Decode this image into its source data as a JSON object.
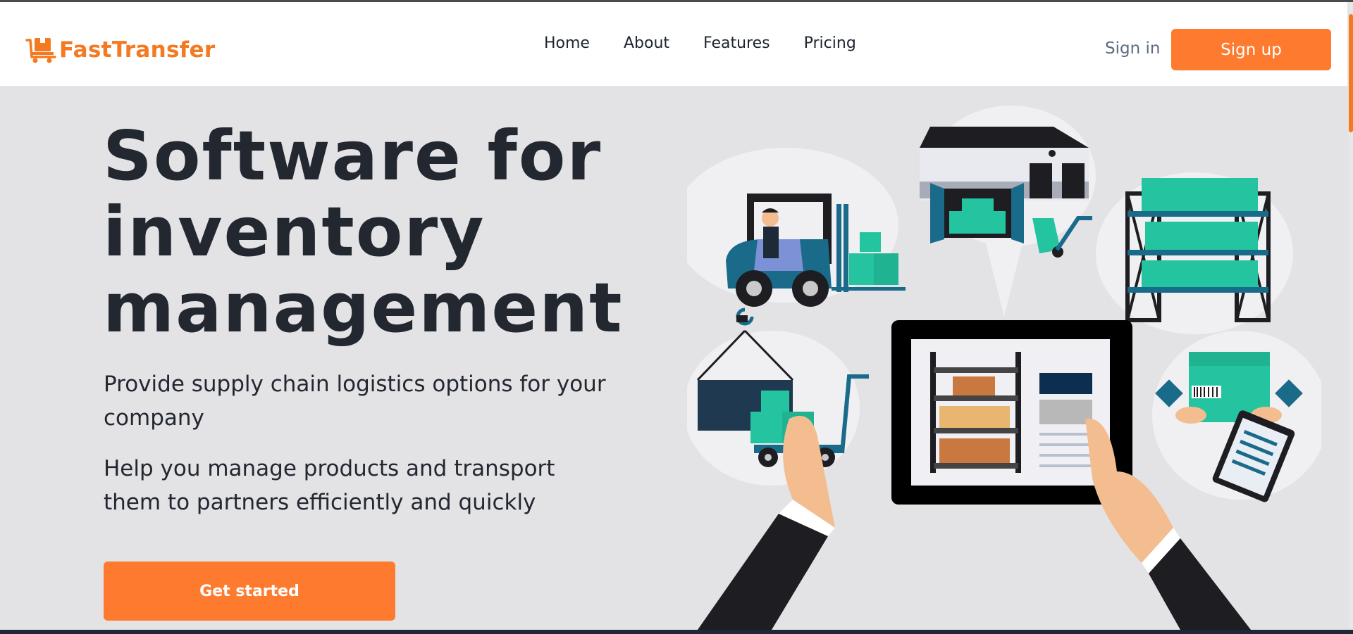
{
  "brand": {
    "name": "FastTransfer",
    "logo_icon": "delivery-box-icon",
    "accent_color": "#f47a21"
  },
  "nav": {
    "items": [
      {
        "label": "Home"
      },
      {
        "label": "About"
      },
      {
        "label": "Features"
      },
      {
        "label": "Pricing"
      }
    ]
  },
  "auth": {
    "sign_in_label": "Sign in",
    "sign_up_label": "Sign up",
    "button_color": "#fd7a2f"
  },
  "hero": {
    "title_lines": [
      "Software for",
      "inventory",
      "management"
    ],
    "paragraph_1": "Provide supply chain logistics options for your company",
    "paragraph_2": "Help you manage products and transport them to partners efficiently and quickly",
    "cta_label": "Get started"
  },
  "illustration": {
    "icon": "warehouse-logistics-illustration"
  }
}
